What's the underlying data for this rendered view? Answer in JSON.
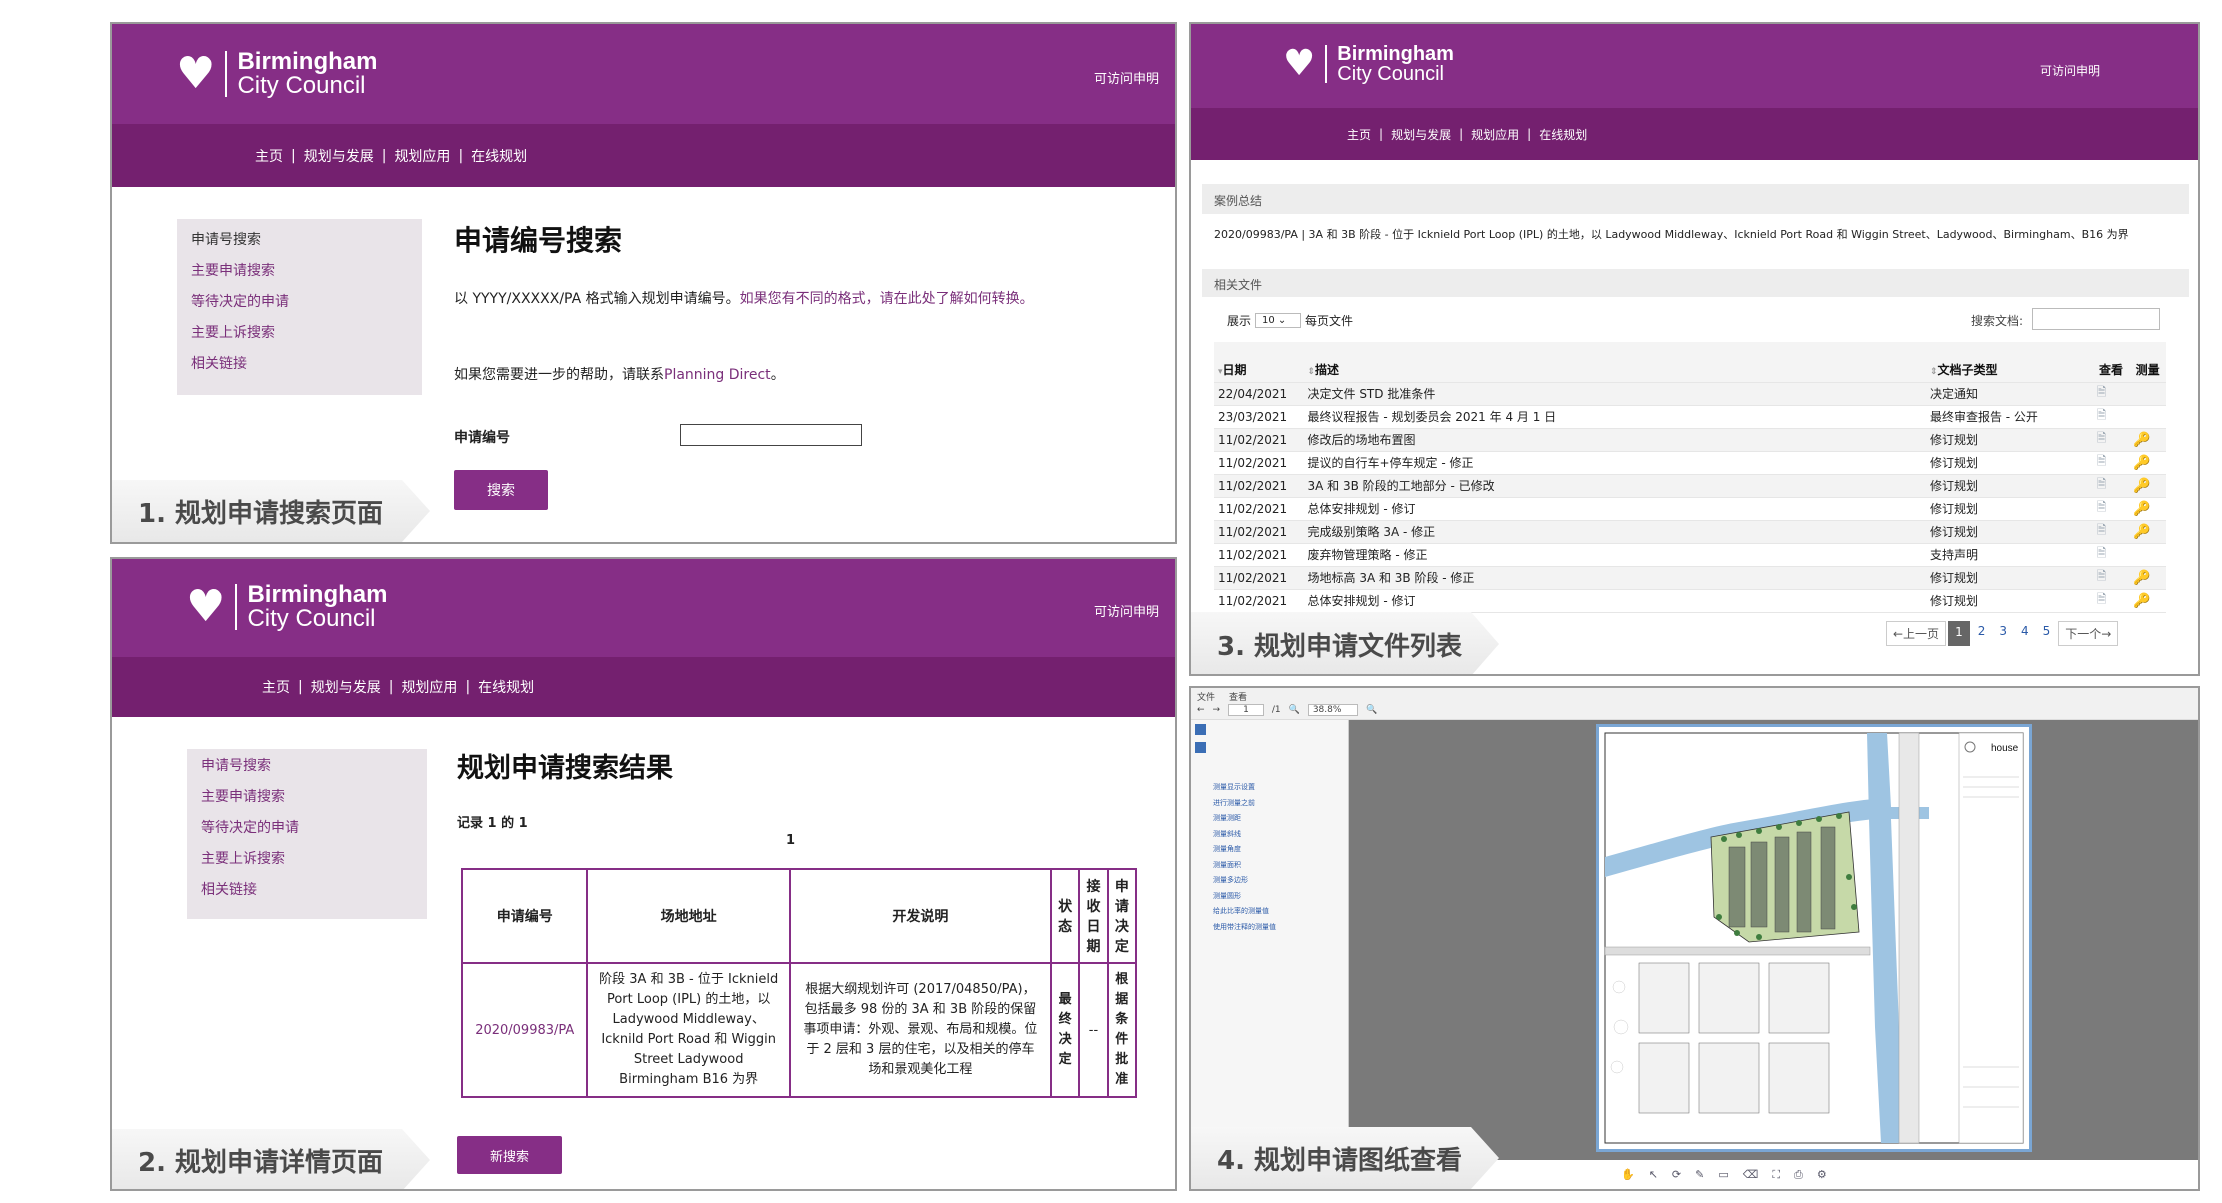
{
  "common": {
    "logo_line1": "Birmingham",
    "logo_line2": "City Council",
    "accessibility": "可访问申明",
    "nav": [
      "主页",
      "规划与发展",
      "规划应用",
      "在线规划"
    ],
    "nav_sep": "|"
  },
  "sidebar": [
    "申请号搜索",
    "主要申请搜索",
    "等待决定的申请",
    "主要上诉搜索",
    "相关链接"
  ],
  "p1": {
    "label": "1. 规划申请搜索页面",
    "title": "申请编号搜索",
    "instruction_prefix": "以 YYYY/XXXXX/PA 格式输入规划申请编号。",
    "instruction_link": "如果您有不同的格式，请在此处了解如何转换。",
    "help_prefix": "如果您需要进一步的帮助，请联系",
    "help_link": "Planning Direct",
    "help_suffix": "。",
    "field_label": "申请编号",
    "search_button": "搜索"
  },
  "p2": {
    "label": "2. 规划申请详情页面",
    "title": "规划申请搜索结果",
    "records": "记录 1 的 1",
    "page_num": "1",
    "headers": [
      "申请编号",
      "场地地址",
      "开发说明",
      "状态",
      "接收日期",
      "申请决定"
    ],
    "row": {
      "ref": "2020/09983/PA",
      "address": "阶段 3A 和 3B - 位于 Icknield Port Loop (IPL) 的土地，以 Ladywood Middleway、Icknild Port Road 和 Wiggin Street Ladywood Birmingham B16 为界",
      "description": "根据大纲规划许可 (2017/04850/PA)，包括最多 98 份的 3A 和 3B 阶段的保留事项申请：外观、景观、布局和规模。位于 2 层和 3 层的住宅，以及相关的停车场和景观美化工程",
      "status": "最终决定",
      "received": "--",
      "decision": "根据条件批准"
    },
    "new_search_button": "新搜索"
  },
  "p3": {
    "label": "3. 规划申请文件列表",
    "case_summary_title": "案例总结",
    "case_summary": "2020/09983/PA | 3A 和 3B 阶段 - 位于 Icknield Port Loop (IPL) 的土地，以 Ladywood Middleway、Icknield Port Road 和 Wiggin Street、Ladywood、Birmingham、B16 为界",
    "related_docs_title": "相关文件",
    "show_label": "展示",
    "show_value": "10",
    "per_page": "每页文件",
    "search_docs": "搜索文档:",
    "columns": [
      "日期",
      "描述",
      "文档子类型",
      "查看",
      "测量"
    ],
    "rows": [
      {
        "date": "22/04/2021",
        "desc": "决定文件 STD 批准条件",
        "type": "决定通知",
        "measure": false
      },
      {
        "date": "23/03/2021",
        "desc": "最终议程报告 - 规划委员会 2021 年 4 月 1 日",
        "type": "最终审查报告 - 公开",
        "measure": false
      },
      {
        "date": "11/02/2021",
        "desc": "修改后的场地布置图",
        "type": "修订规划",
        "measure": true
      },
      {
        "date": "11/02/2021",
        "desc": "提议的自行车+停车规定 - 修正",
        "type": "修订规划",
        "measure": true
      },
      {
        "date": "11/02/2021",
        "desc": "3A 和 3B 阶段的工地部分 - 已修改",
        "type": "修订规划",
        "measure": true
      },
      {
        "date": "11/02/2021",
        "desc": "总体安排规划 - 修订",
        "type": "修订规划",
        "measure": true
      },
      {
        "date": "11/02/2021",
        "desc": "完成级别策略 3A - 修正",
        "type": "修订规划",
        "measure": true
      },
      {
        "date": "11/02/2021",
        "desc": "废弃物管理策略 - 修正",
        "type": "支持声明",
        "measure": false
      },
      {
        "date": "11/02/2021",
        "desc": "场地标高 3A 和 3B 阶段 - 修正",
        "type": "修订规划",
        "measure": true
      },
      {
        "date": "11/02/2021",
        "desc": "总体安排规划 - 修订",
        "type": "修订规划",
        "measure": true
      }
    ],
    "pager": {
      "prev": "←上一页",
      "pages": [
        "1",
        "2",
        "3",
        "4",
        "5"
      ],
      "next": "下一个→"
    }
  },
  "p4": {
    "label": "4. 规划申请图纸查看",
    "zoom": "38.8%",
    "page_input": "1",
    "page_total": "/1",
    "menu": [
      "文件",
      "查看"
    ],
    "sidebar_tools": [
      "测量显示设置",
      "进行测量之前",
      "测量测距",
      "测量斜线",
      "测量角度",
      "测量面积",
      "测量多边形",
      "测量圆形",
      "给此比率的测量值",
      "使用带注释的测量值"
    ],
    "brand": "house"
  }
}
